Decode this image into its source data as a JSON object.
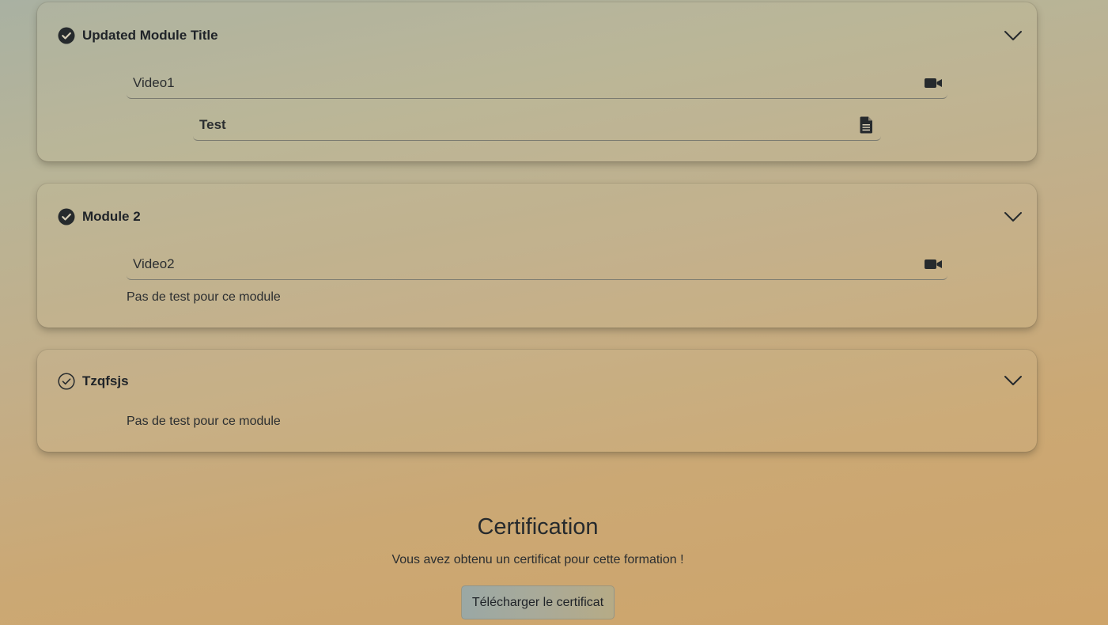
{
  "modules": [
    {
      "title": "Updated Module Title",
      "status": "completed",
      "video": "Video1",
      "test": "Test"
    },
    {
      "title": "Module 2",
      "status": "completed",
      "video": "Video2",
      "no_test": "Pas de test pour ce module"
    },
    {
      "title": "Tzqfsjs",
      "status": "completed-outline",
      "no_test": "Pas de test pour ce module"
    }
  ],
  "certification": {
    "title": "Certification",
    "message": "Vous avez obtenu un certificat pour cette formation !",
    "download_label": "Télécharger le certificat"
  },
  "icons": {
    "completed": "check-circle-filled-icon",
    "completed_outline": "check-circle-outline-icon",
    "expand": "chevron-down-icon",
    "video": "video-camera-icon",
    "test": "document-icon"
  },
  "colors": {
    "text": "#1f2328",
    "icon": "#262a2d"
  }
}
